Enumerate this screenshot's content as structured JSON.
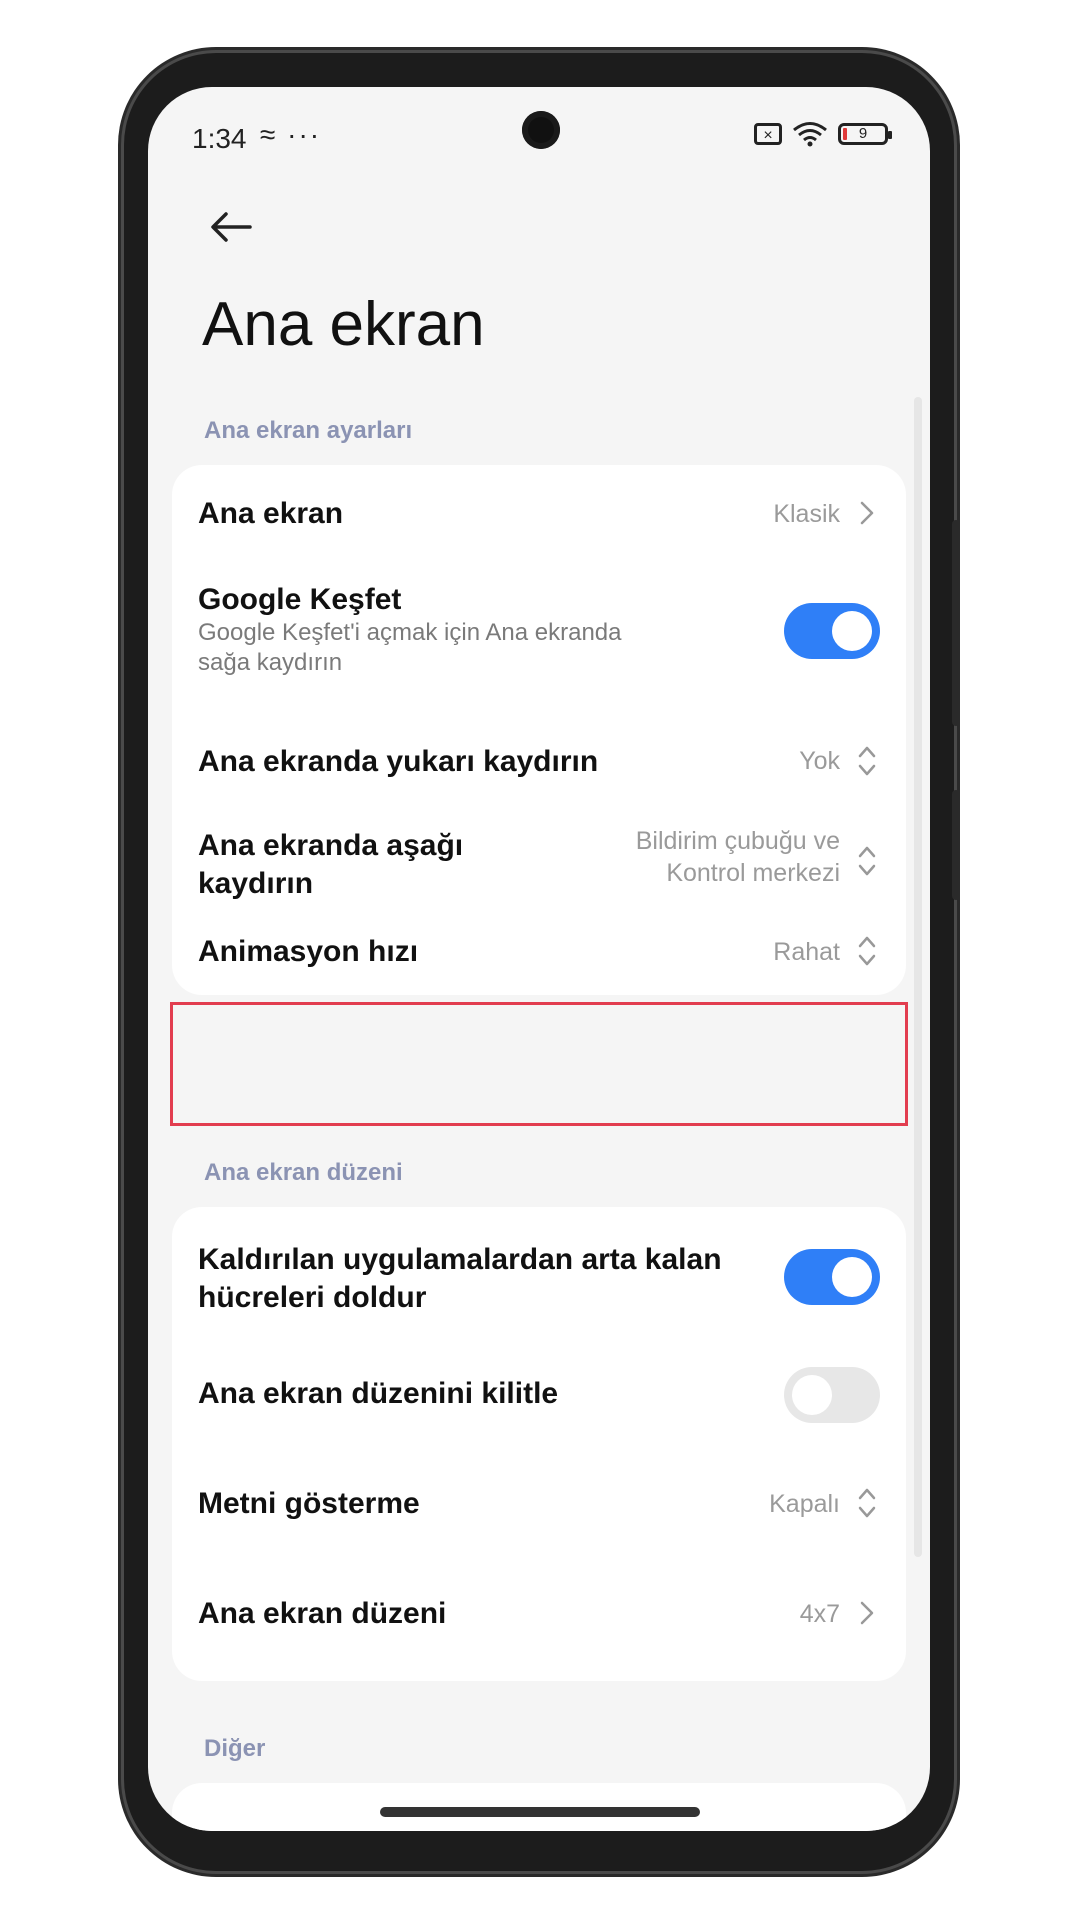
{
  "status_bar": {
    "time": "1:34",
    "extra": "≈ ···",
    "battery_level": "9"
  },
  "header": {
    "back_icon": "arrow-left-icon",
    "title": "Ana ekran"
  },
  "sections": {
    "home_settings": {
      "label": "Ana ekran ayarları",
      "rows": {
        "home_screen": {
          "title": "Ana ekran",
          "value": "Klasik"
        },
        "google_discover": {
          "title": "Google Keşfet",
          "subtitle_line1": "Google Keşfet'i açmak için Ana ekranda",
          "subtitle_line2": "sağa kaydırın",
          "enabled": true
        },
        "swipe_up": {
          "title": "Ana ekranda yukarı kaydırın",
          "value": "Yok"
        },
        "swipe_down": {
          "title_line1": "Ana ekranda aşağı",
          "title_line2": "kaydırın",
          "value_line1": "Bildirim çubuğu ve",
          "value_line2": "Kontrol merkezi"
        },
        "animation_speed": {
          "title": "Animasyon hızı",
          "value": "Rahat"
        }
      }
    },
    "layout": {
      "label": "Ana ekran düzeni",
      "rows": {
        "fill_cells": {
          "title_line1": "Kaldırılan uygulamalardan arta kalan",
          "title_line2": "hücreleri doldur",
          "enabled": true
        },
        "lock_layout": {
          "title": "Ana ekran düzenini kilitle",
          "enabled": false
        },
        "hide_text": {
          "title": "Metni gösterme",
          "value": "Kapalı"
        },
        "grid": {
          "title": "Ana ekran düzeni",
          "value": "4x7"
        }
      }
    },
    "other": {
      "label": "Diğer"
    }
  },
  "colors": {
    "accent": "#2f7ff7",
    "highlight": "#e23d4f",
    "section_label": "#8b93b3"
  }
}
